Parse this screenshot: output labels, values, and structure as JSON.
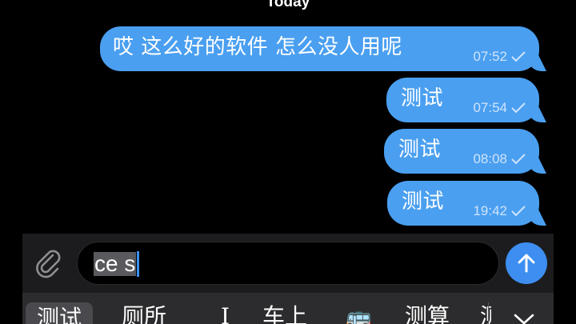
{
  "chat": {
    "date_header": "Today",
    "messages": [
      {
        "text": "哎 这么好的软件 怎么没人用呢",
        "time": "07:52",
        "status": "read-check"
      },
      {
        "text": "测试",
        "time": "07:54",
        "status": "read-check"
      },
      {
        "text": "测试",
        "time": "08:08",
        "status": "read-check"
      },
      {
        "text": "测试",
        "time": "19:42",
        "status": "read-check"
      }
    ]
  },
  "composer": {
    "input_value": "ce s",
    "attach_icon": "paperclip-icon",
    "send_icon": "arrow-up-icon"
  },
  "keyboard": {
    "candidates": [
      "测试",
      "厕所",
      "I",
      "车上",
      "🚌",
      "测算",
      "测"
    ],
    "collapse_icon": "chevron-down-icon"
  },
  "colors": {
    "bubble": "#4a9ff0",
    "send_button": "#3d8ef0",
    "background": "#000000",
    "input_bar": "#1c1c1e",
    "candidate_bar": "#2c2c2e"
  }
}
